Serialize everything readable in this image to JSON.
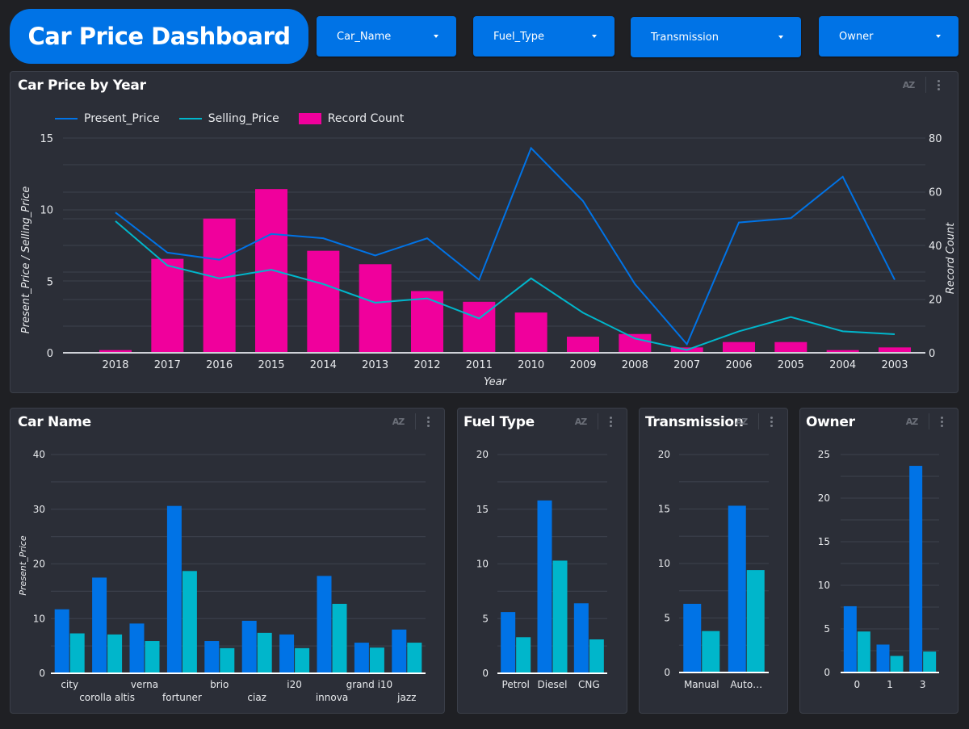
{
  "header": {
    "title": "Car Price Dashboard",
    "filters": [
      {
        "label": "Car_Name"
      },
      {
        "label": "Fuel_Type"
      },
      {
        "label": "Transmission"
      },
      {
        "label": "Owner"
      }
    ]
  },
  "colors": {
    "present_price": "#0073e6",
    "selling_price": "#00b6cb",
    "record_count": "#f0009c",
    "grid": "#3b3f4a",
    "axis_text": "#e8eaed"
  },
  "panel_tools": {
    "sort_icon": "sort-az-icon",
    "menu_icon": "more-vert-icon",
    "sort_label": "AZ"
  },
  "chart_data": [
    {
      "id": "year",
      "type": "bar+line",
      "title": "Car Price by Year",
      "xlabel": "Year",
      "ylabel": "Present_Price / Selling_Price",
      "ylabel_right": "Record Count",
      "ylim": [
        0,
        15
      ],
      "yticks": [
        0,
        5,
        10,
        15
      ],
      "ylim_right": [
        0,
        80
      ],
      "yticks_right": [
        0,
        20,
        40,
        60,
        80
      ],
      "grid": true,
      "legend": "top-left",
      "legend_entries": [
        "Present_Price",
        "Selling_Price",
        "Record Count"
      ],
      "categories": [
        "2018",
        "2017",
        "2016",
        "2015",
        "2014",
        "2013",
        "2012",
        "2011",
        "2010",
        "2009",
        "2008",
        "2007",
        "2006",
        "2005",
        "2004",
        "2003"
      ],
      "series": [
        {
          "name": "Present_Price",
          "kind": "line",
          "axis": "left",
          "values": [
            9.8,
            7.0,
            6.5,
            8.3,
            8.0,
            6.8,
            8.0,
            5.1,
            14.3,
            10.6,
            4.8,
            0.6,
            9.1,
            9.4,
            12.3,
            5.1
          ]
        },
        {
          "name": "Selling_Price",
          "kind": "line",
          "axis": "left",
          "values": [
            9.2,
            6.1,
            5.2,
            5.8,
            4.8,
            3.5,
            3.8,
            2.4,
            5.2,
            2.8,
            1.0,
            0.2,
            1.5,
            2.5,
            1.5,
            1.3
          ]
        },
        {
          "name": "Record Count",
          "kind": "bar",
          "axis": "right",
          "values": [
            1,
            35,
            50,
            61,
            38,
            33,
            23,
            19,
            15,
            6,
            7,
            2,
            4,
            4,
            1,
            2
          ]
        }
      ]
    },
    {
      "id": "carname",
      "type": "bar",
      "title": "Car Name",
      "xlabel": "",
      "ylabel": "Present_Price",
      "ylim": [
        0,
        40
      ],
      "yticks": [
        0,
        10,
        20,
        30,
        40
      ],
      "grid": true,
      "categories": [
        "city",
        "corolla altis",
        "verna",
        "fortuner",
        "brio",
        "ciaz",
        "i20",
        "innova",
        "grand i10",
        "jazz"
      ],
      "series": [
        {
          "name": "Present_Price",
          "values": [
            11.7,
            17.5,
            9.1,
            30.6,
            5.9,
            9.6,
            7.1,
            17.8,
            5.6,
            8.0
          ]
        },
        {
          "name": "Selling_Price",
          "values": [
            7.3,
            7.1,
            5.9,
            18.7,
            4.6,
            7.4,
            4.6,
            12.7,
            4.7,
            5.6
          ]
        }
      ]
    },
    {
      "id": "fuel",
      "type": "bar",
      "title": "Fuel Type",
      "ylim": [
        0,
        20
      ],
      "yticks": [
        0,
        5,
        10,
        15,
        20
      ],
      "grid": true,
      "categories": [
        "Petrol",
        "Diesel",
        "CNG"
      ],
      "series": [
        {
          "name": "Present_Price",
          "values": [
            5.6,
            15.8,
            6.4
          ]
        },
        {
          "name": "Selling_Price",
          "values": [
            3.3,
            10.3,
            3.1
          ]
        }
      ]
    },
    {
      "id": "trans",
      "type": "bar",
      "title": "Transmission",
      "ylim": [
        0,
        20
      ],
      "yticks": [
        0,
        5,
        10,
        15,
        20
      ],
      "grid": true,
      "categories": [
        "Manual",
        "Auto…"
      ],
      "series": [
        {
          "name": "Present_Price",
          "values": [
            6.3,
            15.3
          ]
        },
        {
          "name": "Selling_Price",
          "values": [
            3.8,
            9.4
          ]
        }
      ]
    },
    {
      "id": "owner",
      "type": "bar",
      "title": "Owner",
      "ylim": [
        0,
        25
      ],
      "yticks": [
        0,
        5,
        10,
        15,
        20,
        25
      ],
      "grid": true,
      "categories": [
        "0",
        "1",
        "3"
      ],
      "series": [
        {
          "name": "Present_Price",
          "values": [
            7.6,
            3.2,
            23.7
          ]
        },
        {
          "name": "Selling_Price",
          "values": [
            4.7,
            1.9,
            2.4
          ]
        }
      ]
    }
  ]
}
